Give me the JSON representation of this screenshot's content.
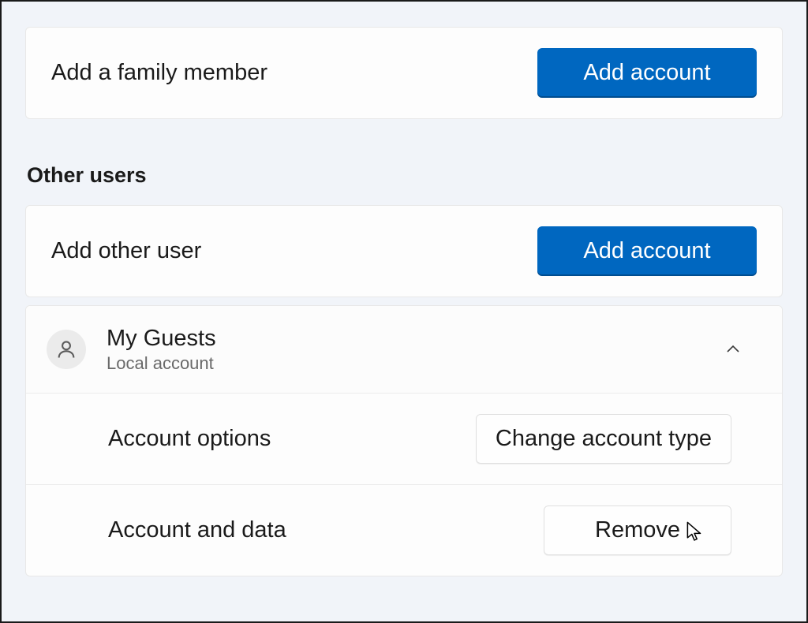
{
  "family": {
    "add_label": "Add a family member",
    "add_button": "Add account"
  },
  "other_users": {
    "heading": "Other users",
    "add_label": "Add other user",
    "add_button": "Add account",
    "user": {
      "name": "My Guests",
      "type": "Local account",
      "options": {
        "account_options_label": "Account options",
        "change_type_button": "Change account type",
        "account_data_label": "Account and data",
        "remove_button": "Remove"
      }
    }
  },
  "colors": {
    "primary": "#0067c0",
    "background": "#f1f4f9",
    "card": "#fdfdfd",
    "text": "#1a1a1a",
    "muted": "#6a6a6a"
  }
}
